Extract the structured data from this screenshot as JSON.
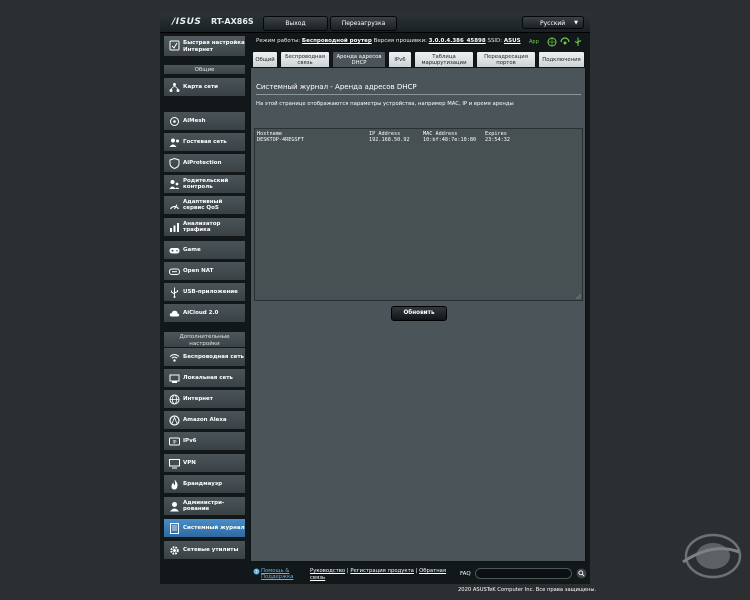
{
  "header": {
    "logo": "/ISUS",
    "model": "RT-AX86S",
    "logout_label": "Выход",
    "reboot_label": "Перезагрузка",
    "language": "Русский"
  },
  "sidebar": {
    "quick_setup_label": "Быстрая настройка Интернет",
    "general_header": "Общие",
    "general_items": [
      {
        "label": "Карта сети"
      },
      {
        "label": "AiMesh"
      },
      {
        "label": "Гостевая сеть"
      },
      {
        "label": "AiProtection"
      },
      {
        "label": "Родительский контроль"
      },
      {
        "label": "Адаптивный сервис QoS"
      },
      {
        "label": "Анализатор трафика"
      },
      {
        "label": "Game"
      },
      {
        "label": "Open NAT"
      },
      {
        "label": "USB-приложение"
      },
      {
        "label": "AiCloud 2.0"
      }
    ],
    "advanced_header": "Дополнительные настройки",
    "advanced_items": [
      {
        "label": "Беспроводная сеть"
      },
      {
        "label": "Локальная сеть"
      },
      {
        "label": "Интернет"
      },
      {
        "label": "Amazon Alexa"
      },
      {
        "label": "IPv6"
      },
      {
        "label": "VPN"
      },
      {
        "label": "Брандмауэр"
      },
      {
        "label": "Администри-рование"
      },
      {
        "label": "Системный журнал"
      },
      {
        "label": "Сетевые утилиты"
      }
    ],
    "active_item": "Системный журнал"
  },
  "status_bar": {
    "mode_label": "Режим работы:",
    "mode_value": "Беспроводной роутер",
    "firmware_label": "Версия прошивки:",
    "firmware_value": "3.0.0.4.386_45898",
    "ssid_label": "SSID:",
    "ssid_value": "ASUS",
    "app_label": "App"
  },
  "tabs": [
    {
      "label": "Общий"
    },
    {
      "label": "Беспроводная связь"
    },
    {
      "label": "Аренда адресов DHCP"
    },
    {
      "label": "IPv6"
    },
    {
      "label": "Таблица маршрутизации"
    },
    {
      "label": "Переадресация портов"
    },
    {
      "label": "Подключения"
    }
  ],
  "active_tab": "Аренда адресов DHCP",
  "content": {
    "title": "Системный журнал - Аренда адресов DHCP",
    "description": "На этой странице отображаются параметры устройства, например MAC, IP и время аренды",
    "log_headers": [
      "Hostname",
      "IP Address",
      "MAC Address",
      "Expires"
    ],
    "log_rows": [
      [
        "DESKTOP-4REGSFT",
        "192.168.50.92",
        "10:bf:48:7e:10:80",
        "23:54:32"
      ]
    ],
    "refresh_label": "Обновить"
  },
  "footer": {
    "help_label": "Помощь & Поддержка",
    "links_prefix": "Руководство",
    "links_mid": "Регистрация продукта",
    "links_suffix": "Обратная связь",
    "faq_label": "FAQ",
    "search_value": "",
    "copyright": "2020 ASUSTeK Computer Inc. Все права защищены."
  },
  "colors": {
    "page_bg": "#2c2f31",
    "frame_bg": "#121719",
    "panel_bg": "#4b5559",
    "active_menu": "#2d6aa1",
    "link_blue": "#5fb3e8",
    "status_green": "#6fd04a"
  }
}
